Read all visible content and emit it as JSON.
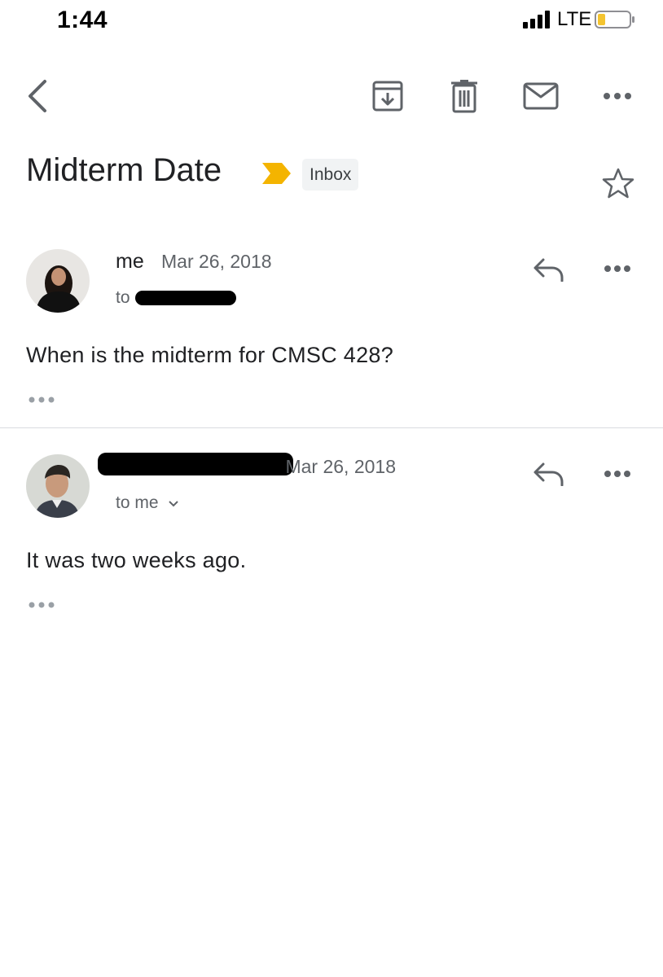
{
  "status_bar": {
    "time": "1:44",
    "carrier": "LTE",
    "battery_color": "#f4c430"
  },
  "toolbar": {
    "back_icon": "chevron-left-icon",
    "archive_icon": "archive-icon",
    "delete_icon": "trash-icon",
    "mark_unread_icon": "mail-icon",
    "more_icon": "more-horizontal-icon"
  },
  "thread": {
    "subject": "Midterm Date",
    "label": "Inbox",
    "importance_color": "#f4b400",
    "messages": [
      {
        "sender": "me",
        "date": "Mar 26, 2018",
        "recipient": "to",
        "body": "When is the midterm for CMSC 428?"
      },
      {
        "sender": "",
        "date": "Mar 26, 2018",
        "recipient": "to me",
        "body": "It was two weeks ago."
      }
    ]
  }
}
